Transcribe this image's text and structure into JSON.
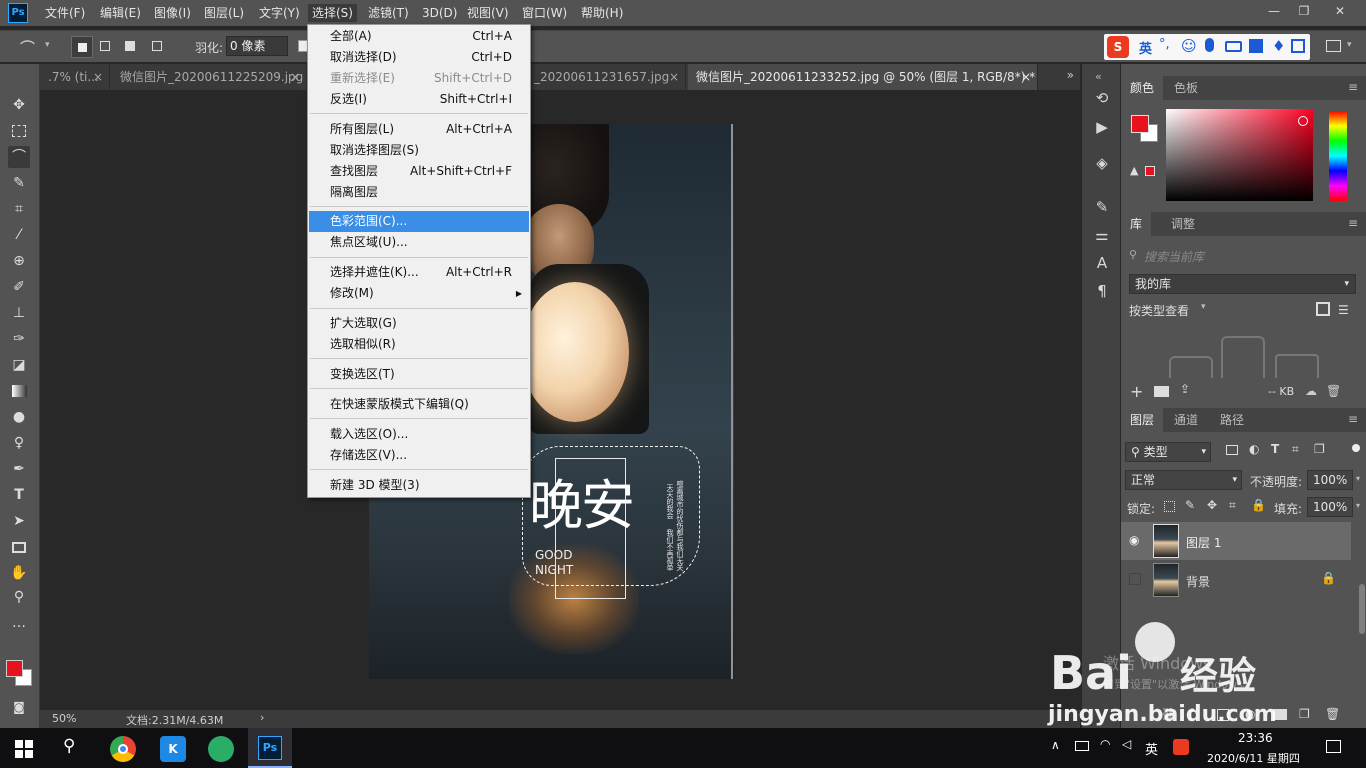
{
  "app": {
    "logo": "Ps"
  },
  "menubar": {
    "items": [
      "文件(F)",
      "编辑(E)",
      "图像(I)",
      "图层(L)",
      "文字(Y)",
      "选择(S)",
      "滤镜(T)",
      "3D(D)",
      "视图(V)",
      "窗口(W)",
      "帮助(H)"
    ],
    "active_index": 5
  },
  "window_controls": {
    "minimize": "—",
    "restore": "❐",
    "close": "✕"
  },
  "options_bar": {
    "feather_label": "羽化:",
    "feather_value": "0 像素"
  },
  "ime": {
    "logo": "S",
    "lang": "英",
    "punct": "°,"
  },
  "tabs": [
    {
      "label": ".7% (ti...",
      "active": false
    },
    {
      "label": "微信图片_20200611225209.jpg",
      "active": false
    },
    {
      "label": "_20200611231657.jpg",
      "active": false
    },
    {
      "label": "微信图片_20200611233252.jpg @ 50% (图层 1, RGB/8*) *",
      "active": true
    }
  ],
  "tab_overflow": "»",
  "select_menu": {
    "groups": [
      [
        {
          "label": "全部(A)",
          "shortcut": "Ctrl+A",
          "disabled": false
        },
        {
          "label": "取消选择(D)",
          "shortcut": "Ctrl+D",
          "disabled": false
        },
        {
          "label": "重新选择(E)",
          "shortcut": "Shift+Ctrl+D",
          "disabled": true
        },
        {
          "label": "反选(I)",
          "shortcut": "Shift+Ctrl+I",
          "disabled": false
        }
      ],
      [
        {
          "label": "所有图层(L)",
          "shortcut": "Alt+Ctrl+A",
          "disabled": false
        },
        {
          "label": "取消选择图层(S)",
          "shortcut": "",
          "disabled": false
        },
        {
          "label": "查找图层",
          "shortcut": "Alt+Shift+Ctrl+F",
          "disabled": false
        },
        {
          "label": "隔离图层",
          "shortcut": "",
          "disabled": false
        }
      ],
      [
        {
          "label": "色彩范围(C)...",
          "shortcut": "",
          "disabled": false,
          "highlighted": true
        },
        {
          "label": "焦点区域(U)...",
          "shortcut": "",
          "disabled": false
        }
      ],
      [
        {
          "label": "选择并遮住(K)...",
          "shortcut": "Alt+Ctrl+R",
          "disabled": false
        },
        {
          "label": "修改(M)",
          "shortcut": "",
          "disabled": false,
          "submenu": true
        }
      ],
      [
        {
          "label": "扩大选取(G)",
          "shortcut": "",
          "disabled": false
        },
        {
          "label": "选取相似(R)",
          "shortcut": "",
          "disabled": false
        }
      ],
      [
        {
          "label": "变换选区(T)",
          "shortcut": "",
          "disabled": false
        }
      ],
      [
        {
          "label": "在快速蒙版模式下编辑(Q)",
          "shortcut": "",
          "disabled": false
        }
      ],
      [
        {
          "label": "载入选区(O)...",
          "shortcut": "",
          "disabled": false
        },
        {
          "label": "存储选区(V)...",
          "shortcut": "",
          "disabled": false
        }
      ],
      [
        {
          "label": "新建 3D 模型(3)",
          "shortcut": "",
          "disabled": false
        }
      ]
    ]
  },
  "canvas_art": {
    "title_big": "晚安",
    "subtitle_en_1": "GOOD",
    "subtitle_en_2": "NIGHT",
    "vertical_lines": [
      "喧嚣城市的忧伤",
      "天天的我会",
      "我们不再孤单",
      "都与我们无关"
    ]
  },
  "status": {
    "zoom": "50%",
    "doc": "文档:2.31M/4.63M",
    "arrow": "›"
  },
  "color_panel": {
    "tab_color": "颜色",
    "tab_swatches": "色板",
    "fg": "#e8121f",
    "bg": "#ffffff",
    "warning": "▲"
  },
  "library_panel": {
    "tab_library": "库",
    "tab_adjust": "调整",
    "search_placeholder": "搜索当前库",
    "library_select": "我的库",
    "view_by": "按类型查看",
    "size": "-- KB"
  },
  "layers_panel": {
    "tab_layers": "图层",
    "tab_channels": "通道",
    "tab_paths": "路径",
    "filter_kind": "类型",
    "blend_mode": "正常",
    "opacity_label": "不透明度:",
    "opacity_value": "100%",
    "lock_label": "锁定:",
    "fill_label": "填充:",
    "fill_value": "100%",
    "layers": [
      {
        "name": "图层 1",
        "visible": true,
        "selected": true,
        "locked": false
      },
      {
        "name": "背景",
        "visible": false,
        "selected": false,
        "locked": true
      }
    ]
  },
  "watermark": {
    "windows_line1": "激活 Windows",
    "windows_line2": "转到\"设置\"以激活 Windows。",
    "baidu": "Bai",
    "baidu_cn": "经验",
    "baidu_url": "jingyan.baidu.com"
  },
  "taskbar": {
    "time": "23:36",
    "date": "2020/6/11 星期四",
    "ime_lang": "英",
    "ps_label": "Ps"
  }
}
